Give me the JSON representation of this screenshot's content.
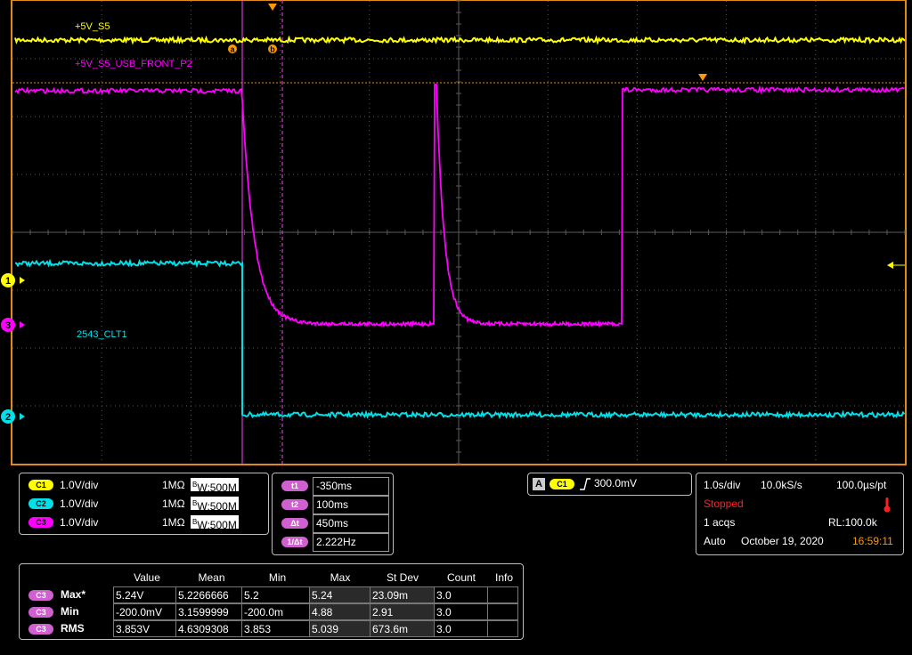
{
  "channels": [
    {
      "id": "C1",
      "label": "+5V_S5",
      "marker": "1",
      "color": "#ffff00",
      "scale": "1.0V/div",
      "impedance": "1MΩ",
      "bandwidth": "500M"
    },
    {
      "id": "C2",
      "label": "2543_CLT1",
      "marker": "2",
      "color": "#00e0e8",
      "scale": "1.0V/div",
      "impedance": "1MΩ",
      "bandwidth": "500M"
    },
    {
      "id": "C3",
      "label": "+5V_S5_USB_FRONT_P2",
      "marker": "3",
      "color": "#ff00ff",
      "scale": "1.0V/div",
      "impedance": "1MΩ",
      "bandwidth": "500M"
    }
  ],
  "cursors": {
    "a_label": "a",
    "b_label": "b",
    "t1_label": "t1",
    "t1": "-350ms",
    "t2_label": "t2",
    "t2": "100ms",
    "dt_label": "Δt",
    "dt": "450ms",
    "inv_dt_label": "1/Δt",
    "inv_dt": "2.222Hz"
  },
  "trigger": {
    "mode_badge": "A",
    "source": "C1",
    "level": "300.0mV"
  },
  "timebase": {
    "time_div": "1.0s/div",
    "sample_rate": "10.0kS/s",
    "resolution": "100.0µs/pt",
    "state": "Stopped",
    "acqs": "1 acqs",
    "record_length": "RL:100.0k",
    "mode": "Auto",
    "date": "October 19, 2020",
    "time": "16:59:11"
  },
  "measurements": {
    "headers": [
      "Value",
      "Mean",
      "Min",
      "Max",
      "St Dev",
      "Count",
      "Info"
    ],
    "rows": [
      {
        "source": "C3",
        "name": "Max*",
        "value": "5.24V",
        "mean": "5.2266666",
        "min": "5.2",
        "max": "5.24",
        "stdev": "23.09m",
        "count": "3.0",
        "info": ""
      },
      {
        "source": "C3",
        "name": "Min",
        "value": "-200.0mV",
        "mean": "3.1599999",
        "min": "-200.0m",
        "max": "4.88",
        "stdev": "2.91",
        "count": "3.0",
        "info": ""
      },
      {
        "source": "C3",
        "name": "RMS",
        "value": "3.853V",
        "mean": "4.6309308",
        "min": "3.853",
        "max": "5.039",
        "stdev": "673.6m",
        "count": "3.0",
        "info": ""
      }
    ]
  },
  "colors": {
    "grid_border": "#e08a1c",
    "grid": "#5a5a5a",
    "cursor": "#ff44ff",
    "trigger_line": "#e08a1c",
    "panel_bg": "#000000",
    "stopped": "#ff2020",
    "time": "#ff9900"
  }
}
